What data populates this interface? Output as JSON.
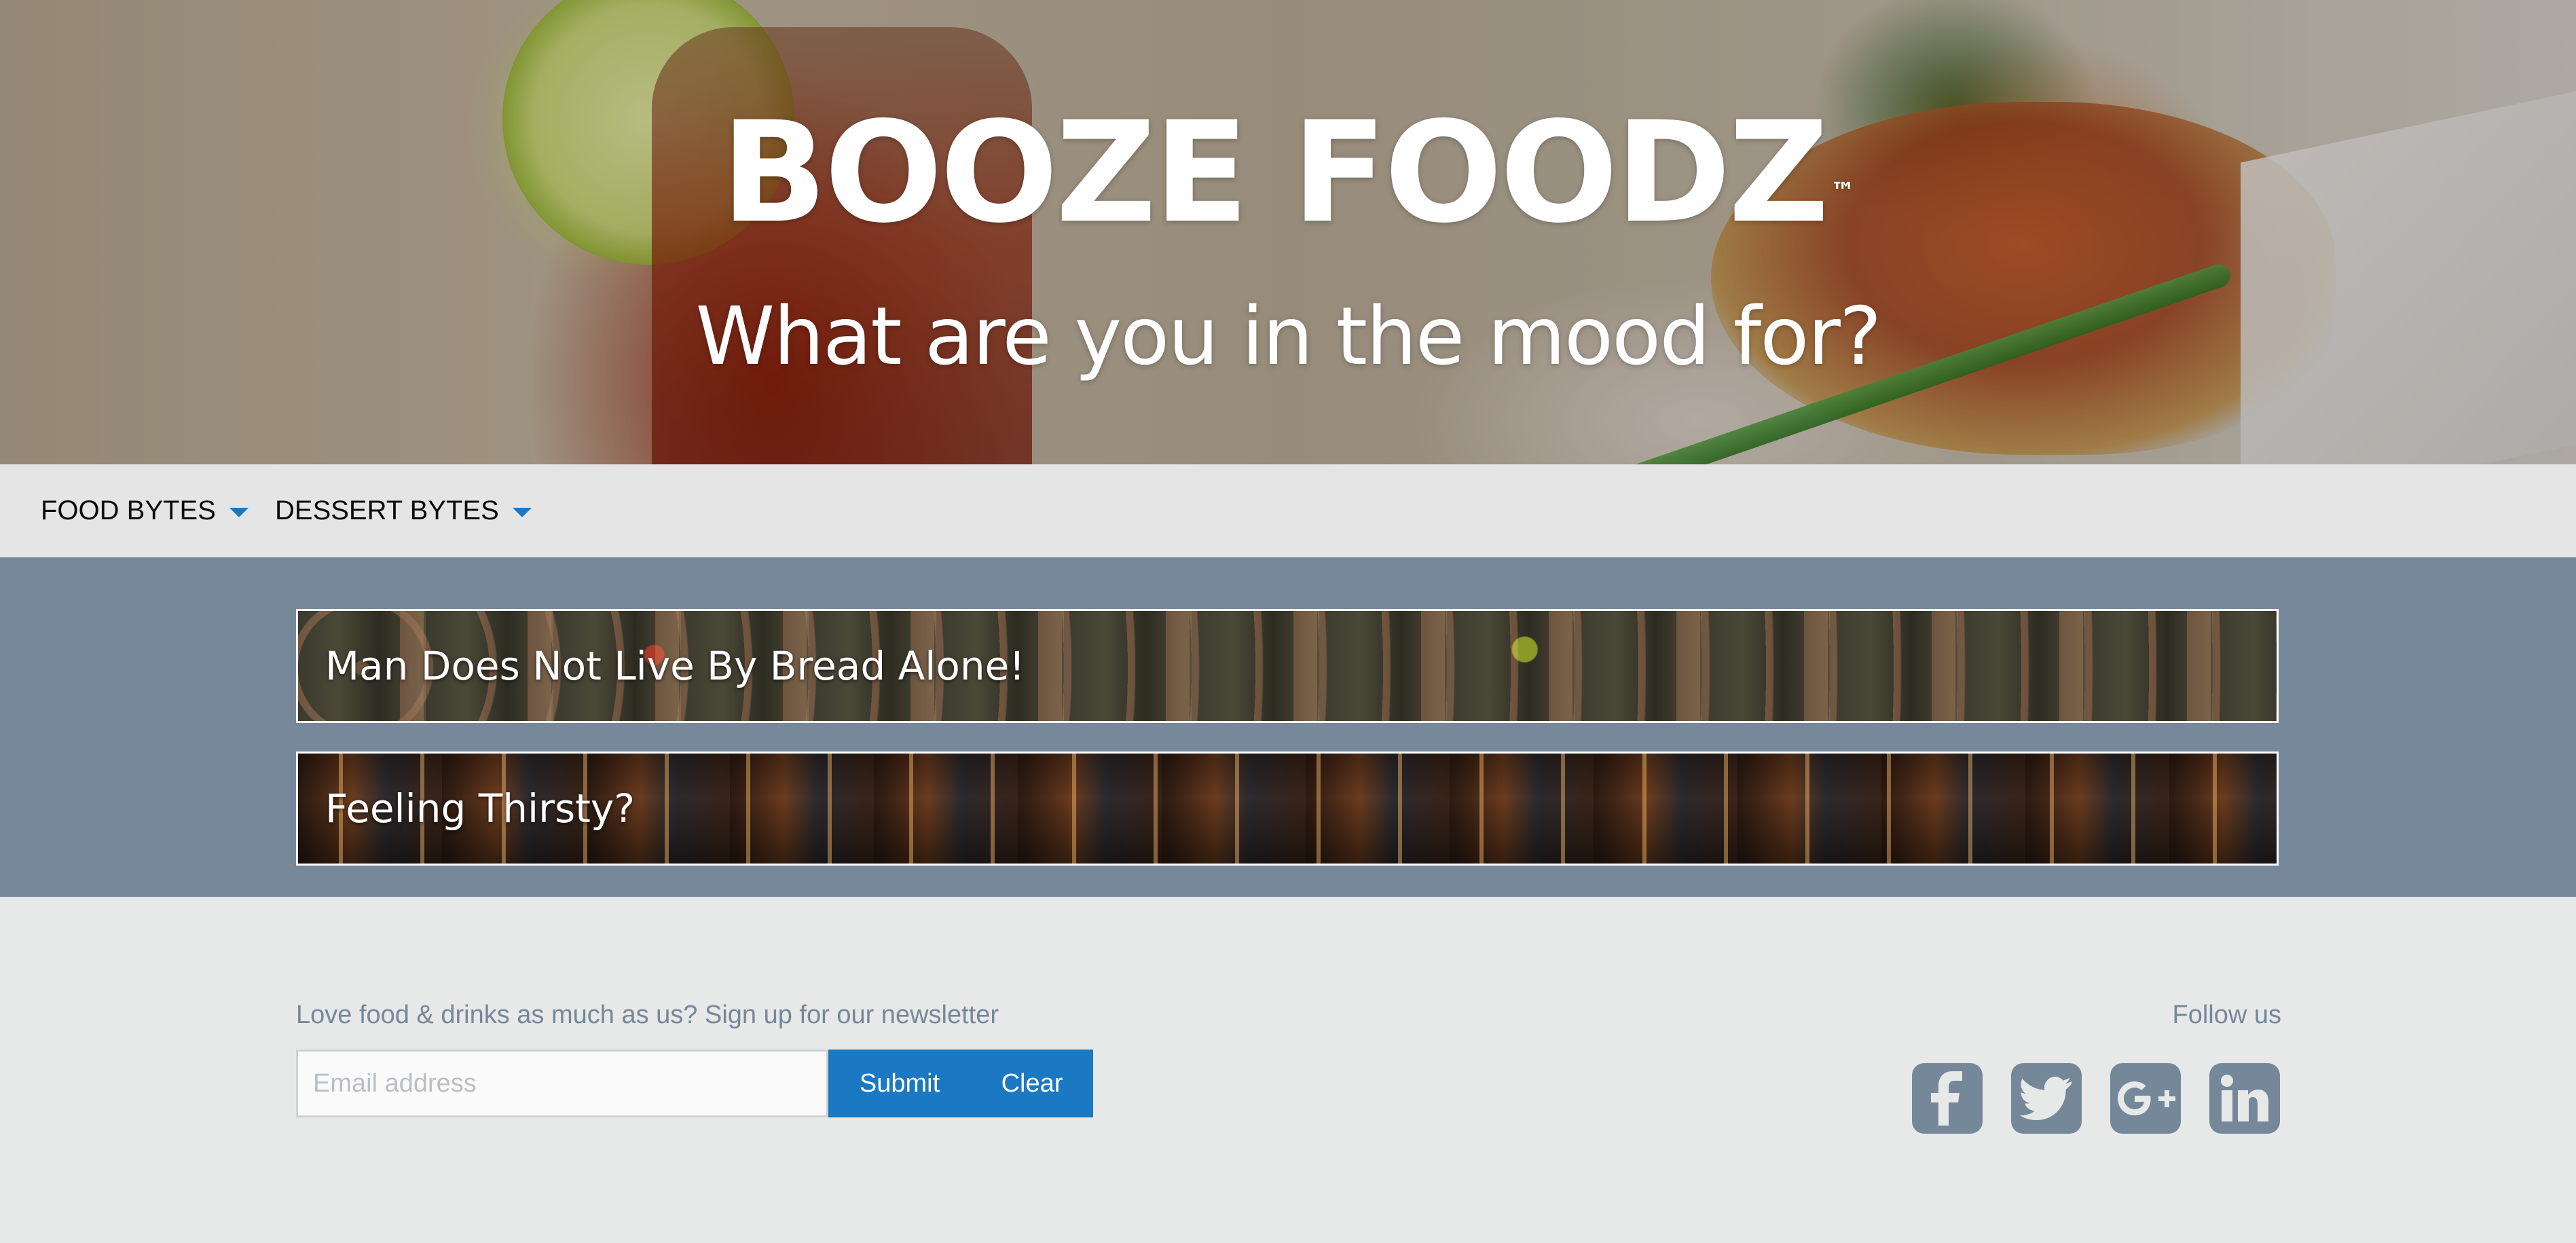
{
  "hero": {
    "title": "BOOZE FOODZ",
    "trademark": "™",
    "subtitle": "What are you in the mood for?"
  },
  "nav": {
    "items": [
      {
        "label": "FOOD BYTES",
        "icon": "caret-down-icon"
      },
      {
        "label": "DESSERT BYTES",
        "icon": "caret-down-icon"
      }
    ],
    "caret_color": "#1b78c2"
  },
  "banners": [
    {
      "label": "Man Does Not Live By Bread Alone!"
    },
    {
      "label": "Feeling Thirsty?"
    }
  ],
  "footer": {
    "newsletter_text": "Love food & drinks as much as us? Sign up for our newsletter",
    "email_placeholder": "Email address",
    "submit_label": "Submit",
    "clear_label": "Clear",
    "follow_text": "Follow us",
    "social": [
      {
        "icon": "facebook-icon"
      },
      {
        "icon": "twitter-icon"
      },
      {
        "icon": "google-plus-icon"
      },
      {
        "icon": "linkedin-icon"
      }
    ]
  },
  "colors": {
    "accent": "#1b78c2",
    "banner_section_bg": "#77889a",
    "muted_text": "#75889a",
    "nav_bg": "#e5e5e5",
    "footer_bg": "#e7e8e8"
  }
}
